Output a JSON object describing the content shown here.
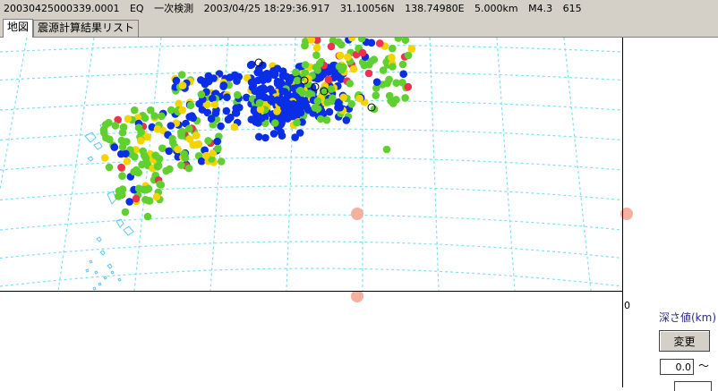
{
  "titlebar": {
    "event_id": "20030425000339.0001",
    "type": "EQ",
    "detection": "一次検測",
    "datetime": "2003/04/25 18:29:36.917",
    "lat": "31.10056N",
    "lon": "138.74980E",
    "depth": "5.000km",
    "mag": "M4.3",
    "count": "615"
  },
  "tabs": [
    {
      "label": "地図",
      "active": true
    },
    {
      "label": "震源計算結果リスト",
      "active": false
    }
  ],
  "panel": {
    "zero_label": "0",
    "depth_label": "深さ値(km)",
    "change_button": "変更",
    "depth_from": "0.0",
    "tilde": "〜"
  },
  "colors": {
    "blue": "#0a2ee6",
    "green": "#60d030",
    "yellow": "#f4d400",
    "red": "#f03050",
    "grid": "#80e0f0",
    "coast": "#60c8f0",
    "marker": "#f6b0a0"
  }
}
